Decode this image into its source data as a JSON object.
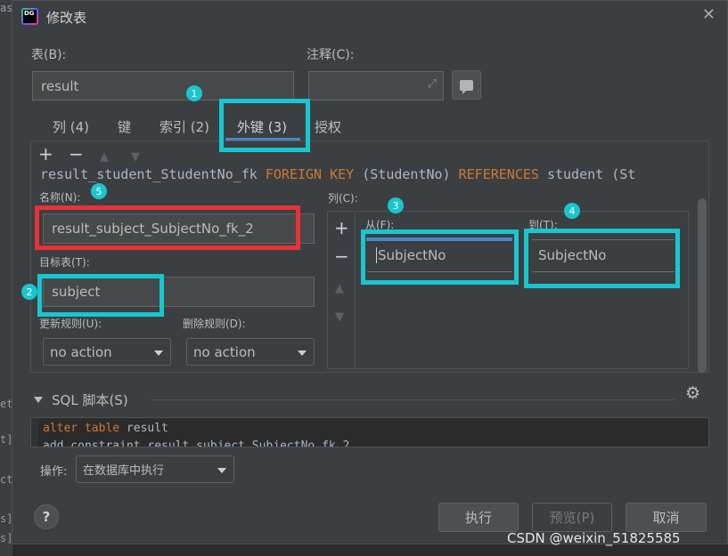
{
  "background": {
    "fragments": [
      "as",
      "et",
      "t]",
      "ct",
      "s]",
      "s]"
    ]
  },
  "dialog": {
    "title": "修改表",
    "app_icon_text": "DG",
    "close_icon": "close-icon"
  },
  "table_field": {
    "label": "表(B):",
    "value": "result"
  },
  "comment_field": {
    "label": "注释(C):",
    "value": ""
  },
  "tabs": [
    {
      "label": "列 (4)"
    },
    {
      "label": "键"
    },
    {
      "label": "索引 (2)"
    },
    {
      "label": "外键 (3)",
      "active": true
    },
    {
      "label": "授权"
    }
  ],
  "toolbar": {
    "add": "+",
    "remove": "−",
    "up": "▲",
    "down": "▼"
  },
  "fk_list_line": {
    "name": "result_student_StudentNo_fk",
    "kw1": "FOREIGN KEY",
    "cols": "(StudentNo)",
    "kw2": "REFERENCES",
    "target": "student (St"
  },
  "fk_form": {
    "name_label": "名称(N):",
    "name_value": "result_subject_SubjectNo_fk_2",
    "target_label": "目标表(T):",
    "target_value": "subject",
    "update_rule_label": "更新规则(U):",
    "update_rule_value": "no action",
    "delete_rule_label": "删除规则(D):",
    "delete_rule_value": "no action",
    "columns_label": "列(C):",
    "from_label": "从(F):",
    "to_label": "到(T):",
    "from_value": "SubjectNo",
    "to_value": "SubjectNo"
  },
  "badges": [
    "1",
    "2",
    "3",
    "4",
    "5"
  ],
  "sql": {
    "header": "SQL 脚本(S)",
    "line1_kw": "alter table",
    "line1_rest": " result",
    "line2": "    add constraint result_subject_SubjectNo_fk_2"
  },
  "operation": {
    "label": "操作:",
    "value": "在数据库中执行"
  },
  "buttons": {
    "help": "?",
    "execute": "执行",
    "preview": "预览(P)",
    "cancel": "取消"
  },
  "watermark": "CSDN @weixin_51825585",
  "colors": {
    "highlight": "#19c6cf",
    "highlight_red": "#e8313a",
    "tab_accent": "#4a88c7",
    "keyword": "#cc7832"
  }
}
